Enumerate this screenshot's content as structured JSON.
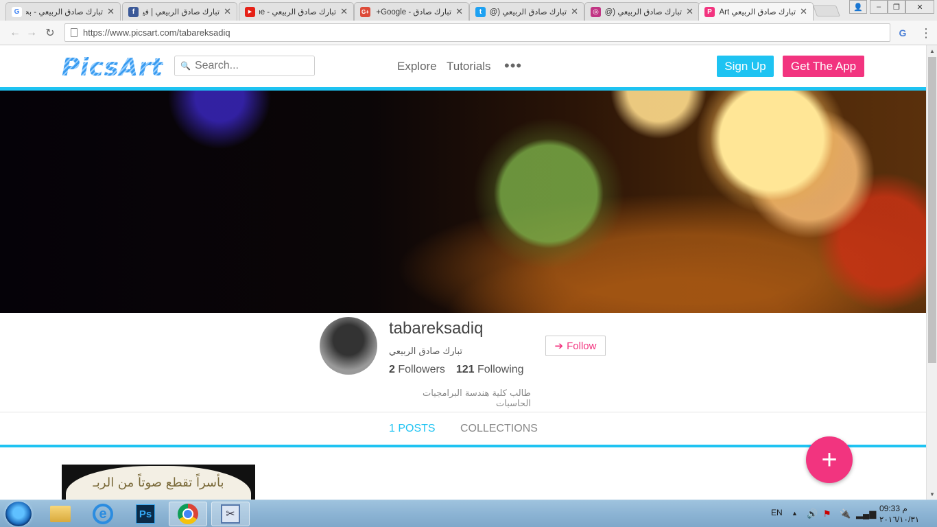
{
  "browser": {
    "tabs": [
      {
        "title": "تبارك صادق الربيعي - بحـ",
        "icon": "google-icon",
        "color": "#4285f4",
        "glyph": "G"
      },
      {
        "title": "تبارك صادق الربيعي | فيسـ",
        "icon": "facebook-icon",
        "color": "#3b5998",
        "glyph": "f"
      },
      {
        "title": "تبارك صادق الربيعي - be",
        "icon": "youtube-icon",
        "color": "#e62117",
        "glyph": "▶"
      },
      {
        "title": "تبارك صادق - Google+",
        "icon": "google-plus-icon",
        "color": "#dd4b39",
        "glyph": "G+"
      },
      {
        "title": "تبارك صادق الربيعي (@",
        "icon": "twitter-icon",
        "color": "#1da1f2",
        "glyph": "t"
      },
      {
        "title": "تبارك صادق الربيعي (@",
        "icon": "instagram-icon",
        "color": "#c13584",
        "glyph": "◎"
      },
      {
        "title": "تبارك صادق الربيعي sArt",
        "icon": "picsart-icon",
        "color": "#f2347f",
        "glyph": "P"
      }
    ],
    "url": "https://www.picsart.com/tabareksadiq"
  },
  "header": {
    "logo": "PicsArt",
    "search_placeholder": "Search...",
    "nav": [
      "Explore",
      "Tutorials"
    ],
    "more": "•••",
    "signup": "Sign Up",
    "get_app": "Get The App"
  },
  "profile": {
    "username": "tabareksadiq",
    "display_name": "تبارك صادق الربيعي",
    "followers_count": "2",
    "followers_label": "Followers",
    "following_count": "121",
    "following_label": "Following",
    "follow_label": "Follow",
    "bio": "طالب كلية هندسة البرامجيات الحاسبات"
  },
  "profile_tabs": {
    "posts": "1 POSTS",
    "collections": "COLLECTIONS"
  },
  "post": {
    "text": "بأسراً تقطع صوتاً من الربـ"
  },
  "fab_label": "+",
  "taskbar": {
    "language": "EN",
    "time": "09:33 م",
    "date": "٢٠١٦/١٠/٣١"
  },
  "colors": {
    "accent_blue": "#1ec3f2",
    "accent_pink": "#f2347f"
  }
}
